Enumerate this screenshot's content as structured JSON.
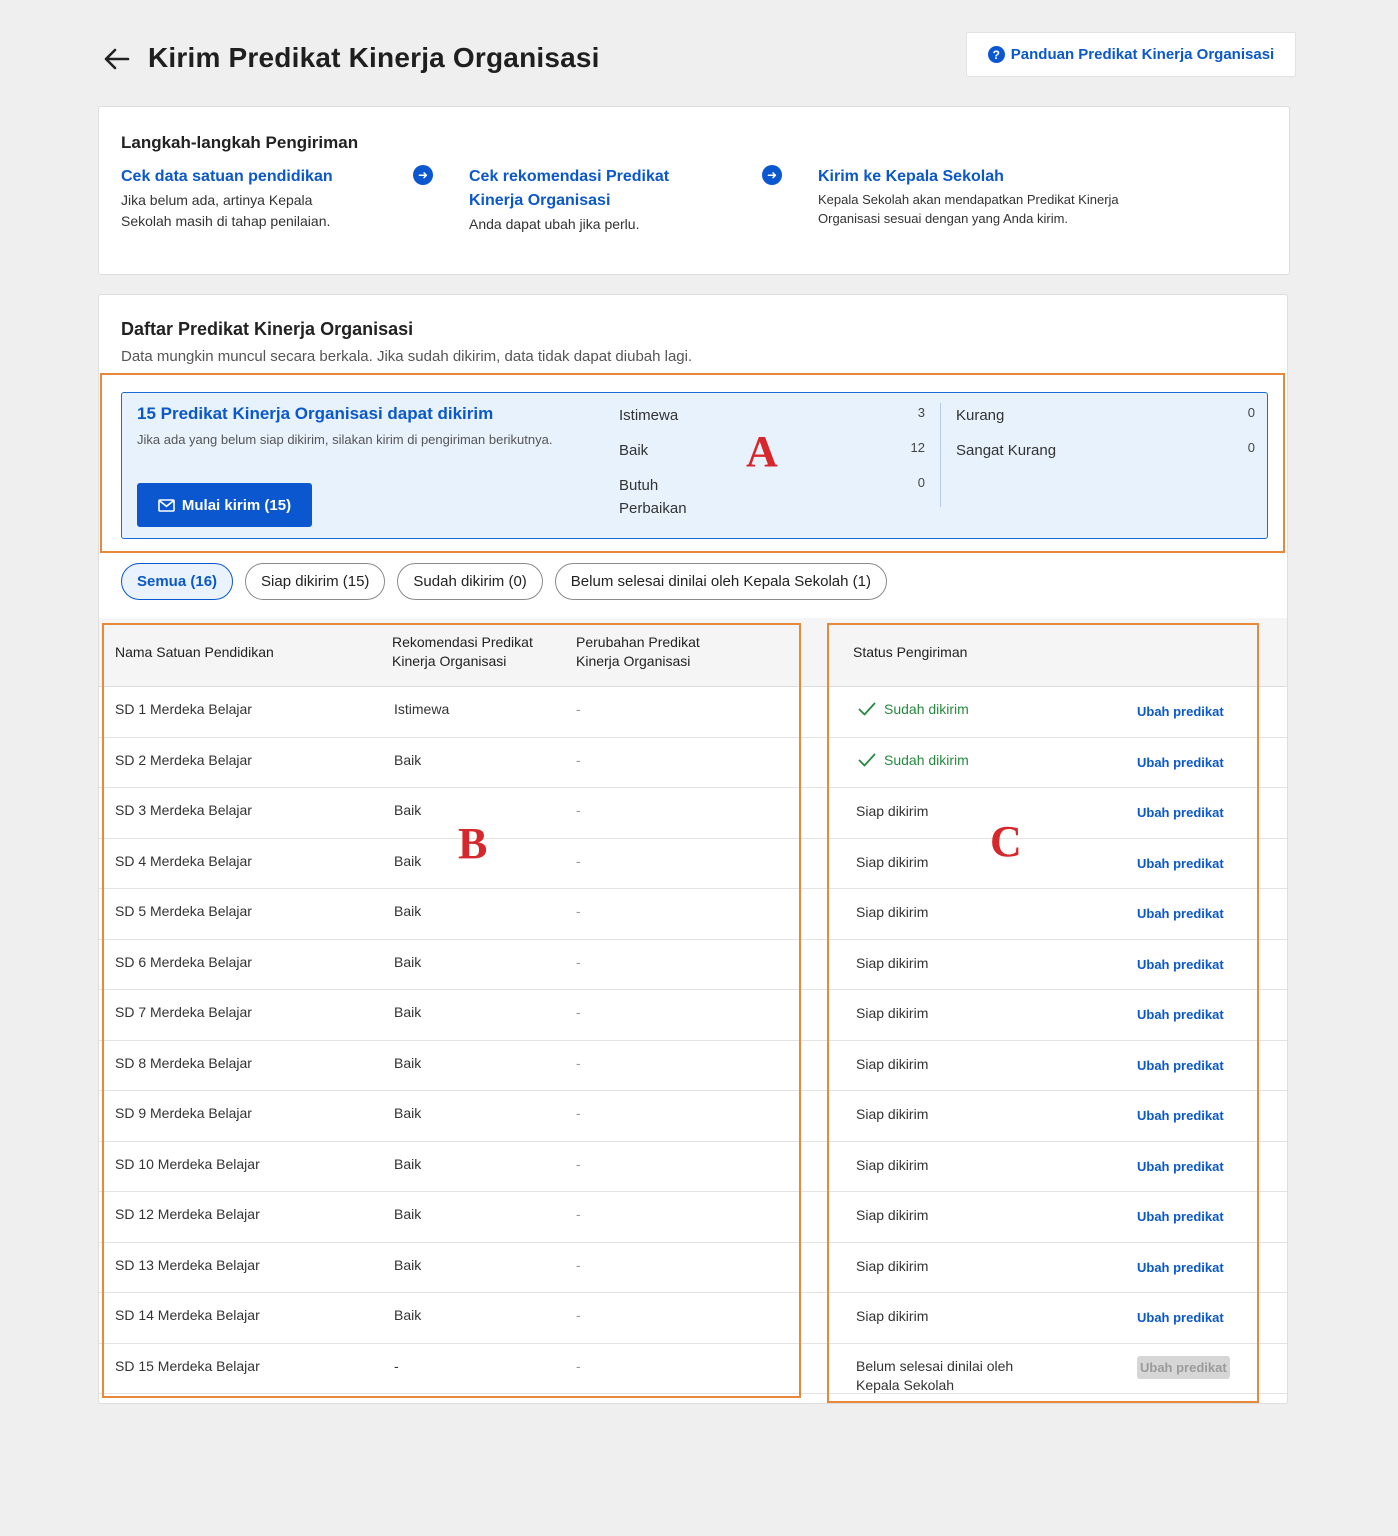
{
  "header": {
    "title": "Kirim Predikat Kinerja Organisasi",
    "guide_label": "Panduan Predikat Kinerja Organisasi"
  },
  "steps": {
    "title": "Langkah-langkah Pengiriman",
    "items": [
      {
        "title": "Cek data satuan pendidikan",
        "desc": "Jika belum ada, artinya Kepala Sekolah masih di tahap penilaian."
      },
      {
        "title": "Cek rekomendasi Predikat Kinerja Organisasi",
        "desc": "Anda dapat ubah jika perlu."
      },
      {
        "title": "Kirim ke Kepala Sekolah",
        "desc": "Kepala Sekolah akan mendapatkan Predikat Kinerja Organisasi sesuai dengan yang Anda kirim."
      }
    ]
  },
  "list": {
    "title": "Daftar Predikat Kinerja Organisasi",
    "subtitle": "Data mungkin muncul secara berkala. Jika sudah dikirim, data tidak dapat diubah lagi."
  },
  "summary": {
    "title": "15 Predikat Kinerja Organisasi dapat dikirim",
    "desc": "Jika ada yang belum siap dikirim, silakan kirim di pengiriman berikutnya.",
    "send_label": "Mulai kirim (15)",
    "categories": [
      {
        "label": "Istimewa",
        "count": "3"
      },
      {
        "label": "Baik",
        "count": "12"
      },
      {
        "label": "Butuh Perbaikan",
        "count": "0"
      },
      {
        "label": "Kurang",
        "count": "0"
      },
      {
        "label": "Sangat Kurang",
        "count": "0"
      }
    ]
  },
  "annotations": {
    "a": "A",
    "b": "B",
    "c": "C"
  },
  "tabs": [
    {
      "label": "Semua (16)",
      "active": true
    },
    {
      "label": "Siap dikirim (15)",
      "active": false
    },
    {
      "label": "Sudah dikirim (0)",
      "active": false
    },
    {
      "label": "Belum selesai dinilai oleh Kepala Sekolah (1)",
      "active": false
    }
  ],
  "table": {
    "headers": {
      "name": "Nama Satuan Pendidikan",
      "recommendation": "Rekomendasi Predikat Kinerja Organisasi",
      "change": "Perubahan Predikat Kinerja Organisasi",
      "status": "Status Pengiriman"
    },
    "action_label": "Ubah predikat",
    "rows": [
      {
        "name": "SD 1 Merdeka Belajar",
        "rec": "Istimewa",
        "change": "-",
        "status": "Sudah dikirim",
        "sent": true,
        "disabled": false
      },
      {
        "name": "SD 2 Merdeka Belajar",
        "rec": "Baik",
        "change": "-",
        "status": "Sudah dikirim",
        "sent": true,
        "disabled": false
      },
      {
        "name": "SD 3 Merdeka Belajar",
        "rec": "Baik",
        "change": "-",
        "status": "Siap dikirim",
        "sent": false,
        "disabled": false
      },
      {
        "name": "SD 4 Merdeka Belajar",
        "rec": "Baik",
        "change": "-",
        "status": "Siap dikirim",
        "sent": false,
        "disabled": false
      },
      {
        "name": "SD 5 Merdeka Belajar",
        "rec": "Baik",
        "change": "-",
        "status": "Siap dikirim",
        "sent": false,
        "disabled": false
      },
      {
        "name": "SD 6 Merdeka Belajar",
        "rec": "Baik",
        "change": "-",
        "status": "Siap dikirim",
        "sent": false,
        "disabled": false
      },
      {
        "name": "SD 7 Merdeka Belajar",
        "rec": "Baik",
        "change": "-",
        "status": "Siap dikirim",
        "sent": false,
        "disabled": false
      },
      {
        "name": "SD 8 Merdeka Belajar",
        "rec": "Baik",
        "change": "-",
        "status": "Siap dikirim",
        "sent": false,
        "disabled": false
      },
      {
        "name": "SD 9 Merdeka Belajar",
        "rec": "Baik",
        "change": "-",
        "status": "Siap dikirim",
        "sent": false,
        "disabled": false
      },
      {
        "name": "SD 10 Merdeka Belajar",
        "rec": "Baik",
        "change": "-",
        "status": "Siap dikirim",
        "sent": false,
        "disabled": false
      },
      {
        "name": "SD 12 Merdeka Belajar",
        "rec": "Baik",
        "change": "-",
        "status": "Siap dikirim",
        "sent": false,
        "disabled": false
      },
      {
        "name": "SD 13 Merdeka Belajar",
        "rec": "Baik",
        "change": "-",
        "status": "Siap dikirim",
        "sent": false,
        "disabled": false
      },
      {
        "name": "SD 14 Merdeka Belajar",
        "rec": "Baik",
        "change": "-",
        "status": "Siap dikirim",
        "sent": false,
        "disabled": false
      },
      {
        "name": "SD 15 Merdeka Belajar",
        "rec": "-",
        "change": "-",
        "status": "Belum selesai dinilai oleh Kepala Sekolah",
        "sent": false,
        "disabled": true
      }
    ]
  }
}
